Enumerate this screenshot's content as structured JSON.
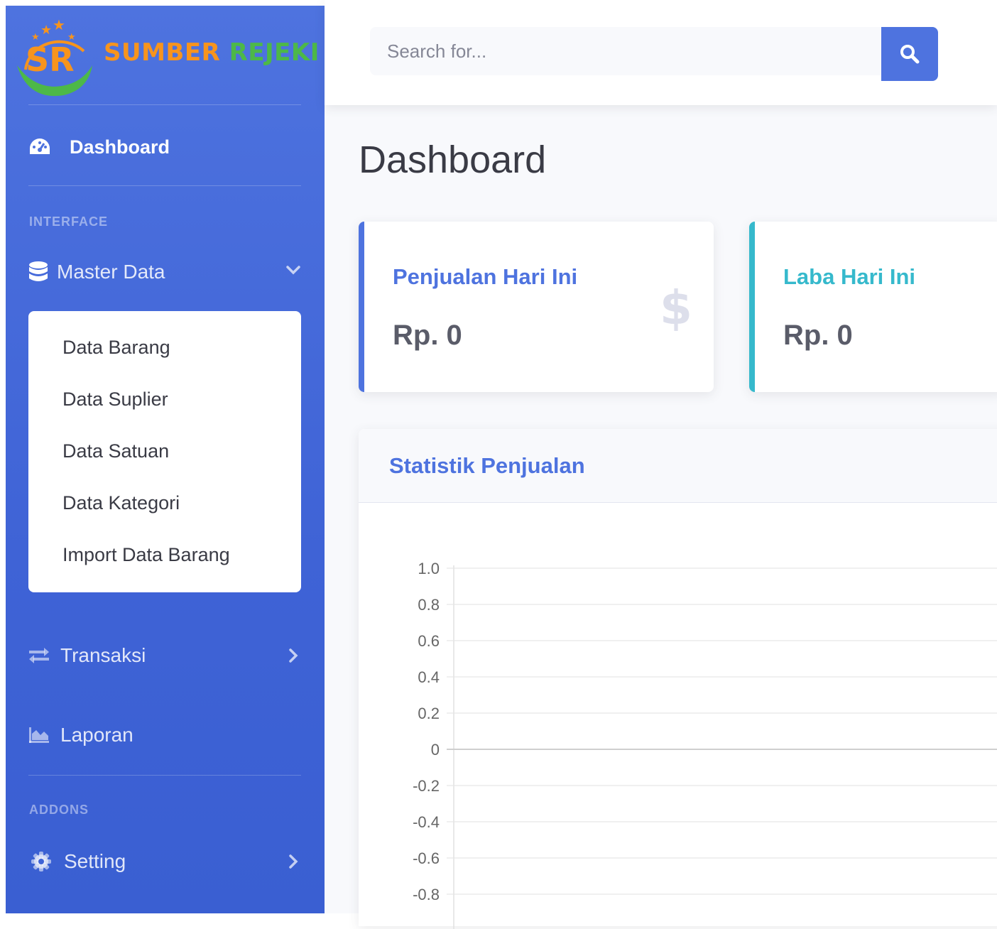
{
  "brand": {
    "logo_initials": "SR",
    "name_part1": "SUMBER",
    "name_part2": "REJEKI"
  },
  "sidebar": {
    "dashboard_label": "Dashboard",
    "heading_interface": "INTERFACE",
    "master_data_label": "Master Data",
    "master_data_items": [
      "Data Barang",
      "Data Suplier",
      "Data Satuan",
      "Data Kategori",
      "Import Data Barang"
    ],
    "transaksi_label": "Transaksi",
    "laporan_label": "Laporan",
    "heading_addons": "ADDONS",
    "setting_label": "Setting"
  },
  "topbar": {
    "search_placeholder": "Search for..."
  },
  "page": {
    "title": "Dashboard"
  },
  "cards": {
    "sales_today": {
      "title": "Penjualan Hari Ini",
      "value": "Rp. 0",
      "icon": "dollar-icon"
    },
    "profit_today": {
      "title": "Laba Hari Ini",
      "value": "Rp. 0"
    }
  },
  "colors": {
    "primary": "#4e73df",
    "info": "#36b9cc",
    "text_dark": "#3a3b45",
    "brand_orange": "#f7941d",
    "brand_green": "#4db848"
  },
  "chart_section": {
    "title": "Statistik Penjualan"
  },
  "chart_data": {
    "type": "line",
    "title": "",
    "xlabel": "",
    "ylabel": "",
    "ylim": [
      -1.0,
      1.0
    ],
    "y_ticks": [
      "1.0",
      "0.8",
      "0.6",
      "0.4",
      "0.2",
      "0",
      "-0.2",
      "-0.4",
      "-0.6",
      "-0.8"
    ],
    "categories": [],
    "series": [],
    "grid": true
  }
}
